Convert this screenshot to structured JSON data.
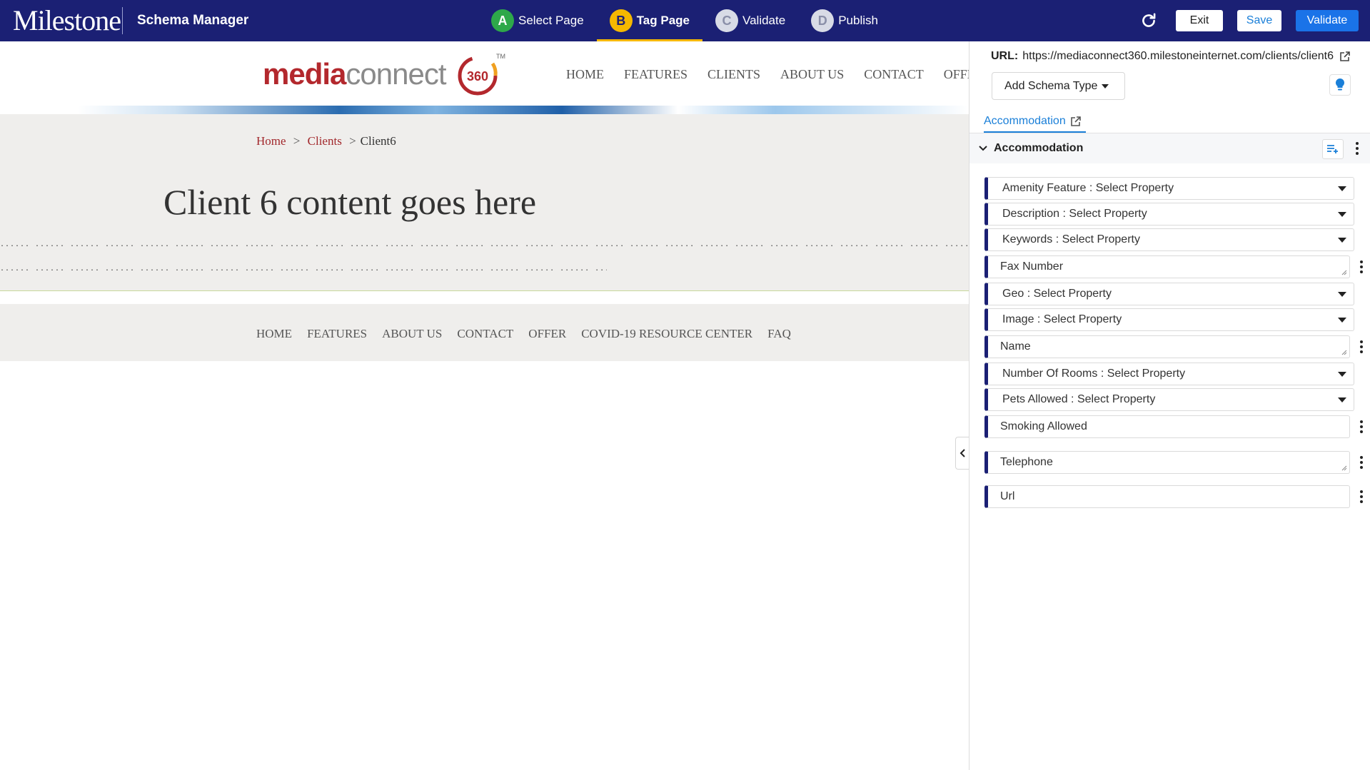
{
  "topbar": {
    "logo": "Milestone",
    "app_title": "Schema Manager",
    "steps": [
      {
        "letter": "A",
        "label": "Select Page",
        "color": "#2ea84a",
        "text_color": "#ffffff",
        "active": false
      },
      {
        "letter": "B",
        "label": "Tag Page",
        "color": "#f5b800",
        "text_color": "#1b2074",
        "active": true
      },
      {
        "letter": "C",
        "label": "Validate",
        "color": "#d8dbe6",
        "text_color": "#8a8fa8",
        "active": false
      },
      {
        "letter": "D",
        "label": "Publish",
        "color": "#d8dbe6",
        "text_color": "#8a8fa8",
        "active": false
      }
    ],
    "refresh_icon": "refresh-icon",
    "exit_label": "Exit",
    "save_label": "Save",
    "validate_label": "Validate"
  },
  "site": {
    "logo_media": "media",
    "logo_connect": "connect",
    "logo_badge": "360",
    "logo_tm": "TM",
    "nav": [
      "HOME",
      "FEATURES",
      "CLIENTS",
      "ABOUT US",
      "CONTACT",
      "OFFER"
    ],
    "breadcrumb": {
      "home": "Home",
      "sep1": ">",
      "clients": "Clients",
      "sep2": ">",
      "current": "Client6"
    },
    "heading": "Client 6 content goes here",
    "footer_nav": [
      "HOME",
      "FEATURES",
      "ABOUT US",
      "CONTACT",
      "OFFER",
      "COVID-19 RESOURCE CENTER",
      "FAQ"
    ]
  },
  "panel": {
    "url_label": "URL:",
    "url_value": "https://mediaconnect360.milestoneinternet.com/clients/client6",
    "add_schema_label": "Add Schema Type",
    "tab_label": "Accommodation",
    "section_title": "Accommodation",
    "properties": [
      {
        "label": "Amenity Feature : Select Property",
        "kind": "select"
      },
      {
        "label": "Description : Select Property",
        "kind": "select"
      },
      {
        "label": "Keywords : Select Property",
        "kind": "select"
      },
      {
        "label": "Fax Number",
        "kind": "text"
      },
      {
        "label": "Geo : Select Property",
        "kind": "select"
      },
      {
        "label": "Image : Select Property",
        "kind": "select"
      },
      {
        "label": "Name",
        "kind": "text"
      },
      {
        "label": "Number Of Rooms : Select Property",
        "kind": "select"
      },
      {
        "label": "Pets Allowed : Select Property",
        "kind": "select"
      },
      {
        "label": "Smoking Allowed",
        "kind": "text"
      },
      {
        "label": "Telephone",
        "kind": "text"
      },
      {
        "label": "Url",
        "kind": "text"
      }
    ]
  },
  "colors": {
    "topbar_bg": "#1b2074",
    "accent_blue": "#1a7fd8",
    "brand_red": "#b3282d"
  }
}
